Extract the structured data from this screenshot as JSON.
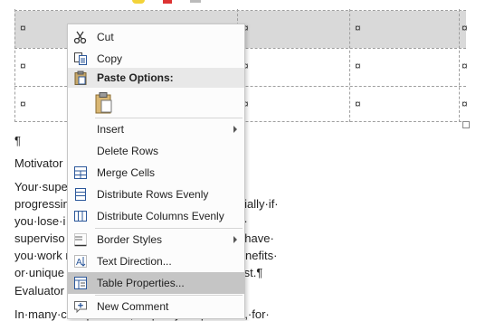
{
  "table": {
    "cell_mark": "¤",
    "row_mark": "¤"
  },
  "document": {
    "pilcrow": "¶",
    "heading_motivator": "Motivator",
    "line1": "Your·supe                                                  ole·as·motivator·and·keep·you·",
    "line2": "progressin                                                ften·the·most·difficult·role,·especially·if·",
    "line3": "you·lose·i                                                 interest,·it·is·very·difficult·for·your·",
    "line4": "superviso                                                 ach·that·he·or·she·might·try·is·to·have·",
    "line5": "you·work                                                  roject.·If·you·can·see·the·“real”·benefits·",
    "line6": "or·unique                                                  etimes·can·gain·a·renewed·interest.¶",
    "heading_evaluator": "Evaluator",
    "line7": "In·many·c                                                  responsible,·or·partly·responsible,·for·"
  },
  "context_menu": {
    "items": [
      {
        "label": "Cut",
        "icon": "scissors-icon"
      },
      {
        "label": "Copy",
        "icon": "copy-icon"
      },
      {
        "label": "Paste Options:",
        "icon": "clipboard-icon"
      },
      {
        "label": "Insert",
        "icon": "",
        "submenu": true
      },
      {
        "label": "Delete Rows",
        "icon": ""
      },
      {
        "label": "Merge Cells",
        "icon": "merge-cells-icon"
      },
      {
        "label": "Distribute Rows Evenly",
        "icon": "distribute-rows-icon"
      },
      {
        "label": "Distribute Columns Evenly",
        "icon": "distribute-columns-icon"
      },
      {
        "label": "Border Styles",
        "icon": "border-styles-icon",
        "submenu": true
      },
      {
        "label": "Text Direction...",
        "icon": "text-direction-icon"
      },
      {
        "label": "Table Properties...",
        "icon": "table-properties-icon",
        "highlighted": true
      },
      {
        "label": "New Comment",
        "icon": "new-comment-icon"
      }
    ]
  },
  "colors": {
    "selected_row": "#d9d9d9",
    "menu_highlight": "#c5c5c5",
    "icon_blue": "#2b579a"
  }
}
